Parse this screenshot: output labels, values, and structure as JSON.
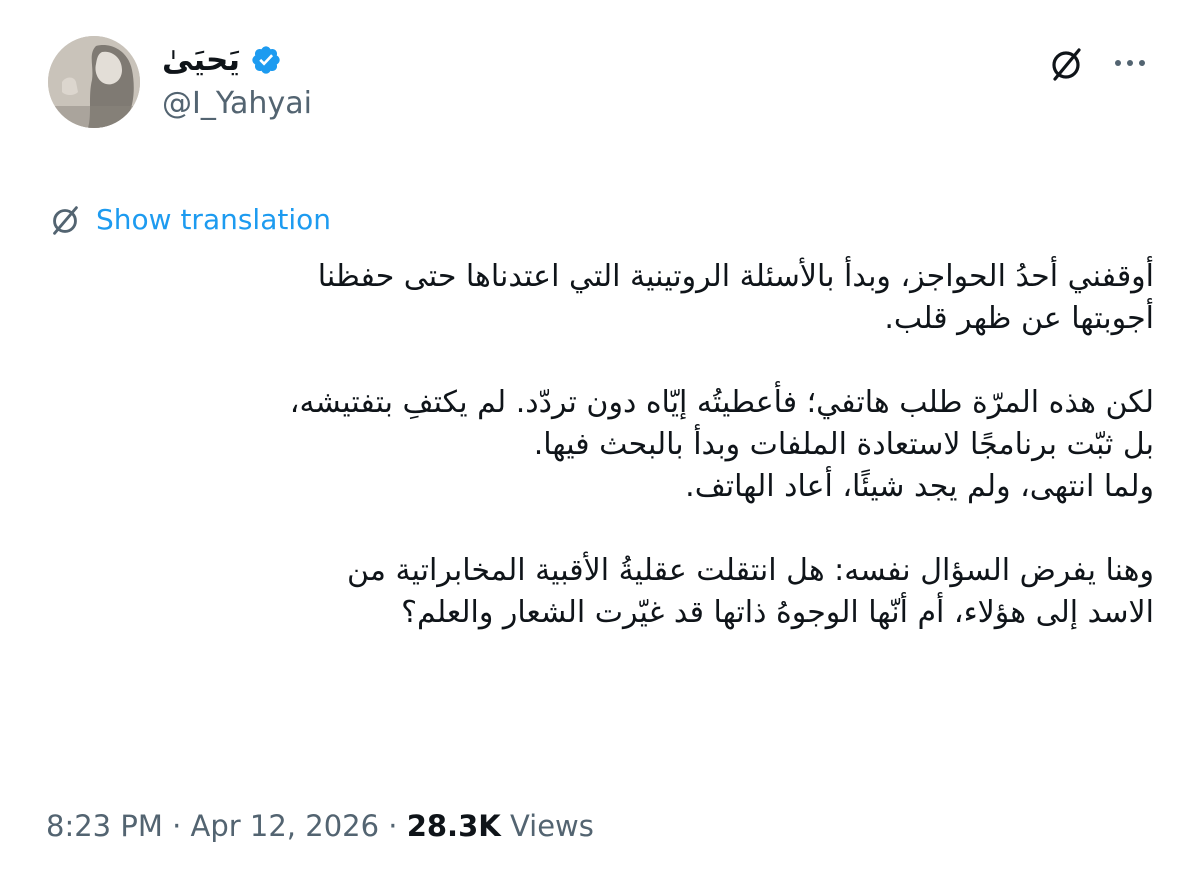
{
  "author": {
    "display_name": "يَحيَىٰ",
    "handle": "@I_Yahyai",
    "verified": true,
    "verified_color": "#1d9bf0"
  },
  "header": {
    "translate_icon": "translate-icon",
    "more_icon": "more-icon"
  },
  "translation": {
    "label": "Show translation",
    "color": "#1d9bf0"
  },
  "tweet": {
    "paragraphs": [
      [
        "أوقفني أحدُ الحواجز، وبدأ بالأسئلة الروتينية التي اعتدناها حتى حفظنا",
        "أجوبتها عن ظهر قلب."
      ],
      [
        "لكن هذه المرّة طلب هاتفي؛ فأعطيتُه إيّاه دون تردّد. لم يكتفِ بتفتيشه،",
        "بل ثبّت برنامجًا لاستعادة الملفات وبدأ بالبحث فيها.",
        "ولما انتهى، ولم يجد شيئًا، أعاد الهاتف."
      ],
      [
        "وهنا يفرض السؤال نفسه: هل انتقلت عقليةُ الأقبية المخابراتية من",
        "الاسد إلى هؤلاء، أم أنّها الوجوهُ ذاتها قد غيّرت الشعار والعلم؟"
      ]
    ]
  },
  "meta": {
    "time": "8:23 PM",
    "separator": " · ",
    "date": "Apr 12, 2026",
    "views_count": "28.3K",
    "views_label": "Views"
  }
}
